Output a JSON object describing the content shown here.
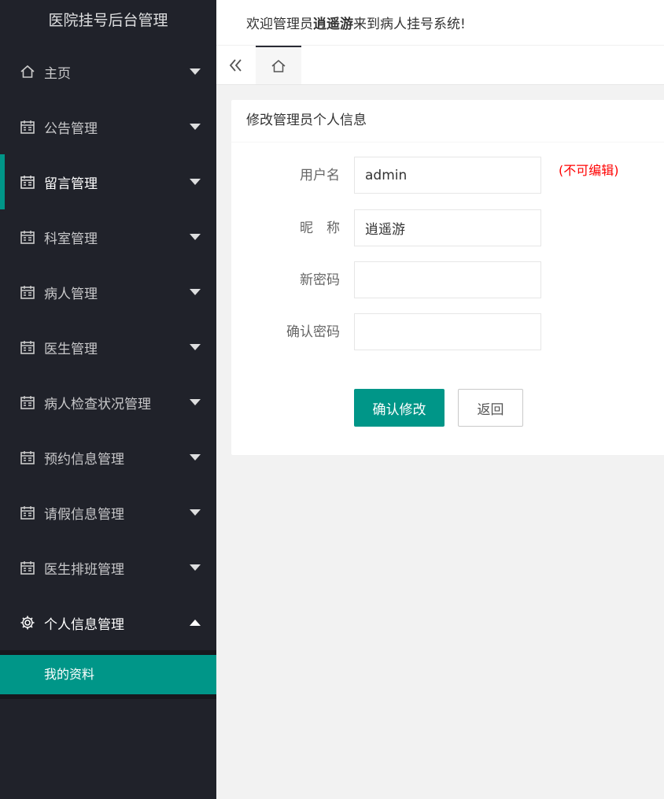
{
  "sidebar": {
    "logo": "医院挂号后台管理",
    "items": [
      {
        "label": "主页",
        "icon": "home-icon"
      },
      {
        "label": "公告管理",
        "icon": "calendar-icon"
      },
      {
        "label": "留言管理",
        "icon": "calendar-icon"
      },
      {
        "label": "科室管理",
        "icon": "calendar-icon"
      },
      {
        "label": "病人管理",
        "icon": "calendar-icon"
      },
      {
        "label": "医生管理",
        "icon": "calendar-icon"
      },
      {
        "label": "病人检查状况管理",
        "icon": "calendar-icon"
      },
      {
        "label": "预约信息管理",
        "icon": "calendar-icon"
      },
      {
        "label": "请假信息管理",
        "icon": "calendar-icon"
      },
      {
        "label": "医生排班管理",
        "icon": "calendar-icon"
      },
      {
        "label": "个人信息管理",
        "icon": "gear-icon"
      }
    ],
    "sub_items": [
      {
        "label": "我的资料"
      }
    ]
  },
  "header": {
    "welcome_prefix": "欢迎管理员",
    "username": "逍遥游",
    "welcome_suffix": "来到病人挂号系统!"
  },
  "tabs": {
    "collapse_icon": "double-chevron-left-icon",
    "home_icon": "home-icon"
  },
  "card": {
    "title": "修改管理员个人信息",
    "fields": {
      "username": {
        "label": "用户名",
        "value": "admin",
        "note": "(不可编辑)"
      },
      "nickname": {
        "label": "昵　称",
        "value": "逍遥游"
      },
      "new_password": {
        "label": "新密码",
        "value": ""
      },
      "confirm_password": {
        "label": "确认密码",
        "value": ""
      }
    },
    "submit_label": "确认修改",
    "back_label": "返回"
  },
  "colors": {
    "accent": "#009688",
    "sidebar_bg": "#20222a",
    "warning": "#ff0000"
  }
}
